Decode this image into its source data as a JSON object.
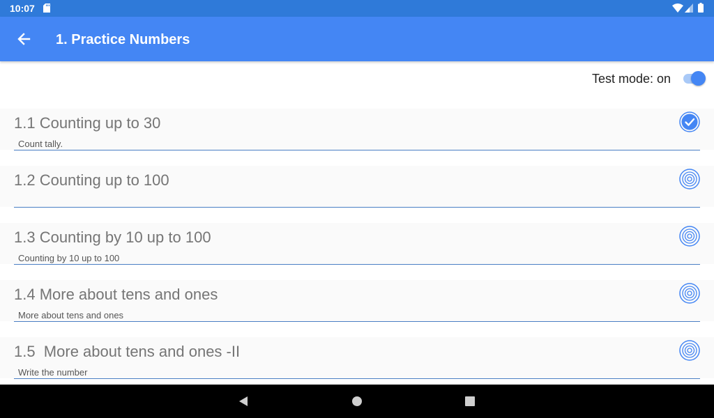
{
  "status_bar": {
    "time": "10:07",
    "color": "#2f7ad9"
  },
  "app_bar": {
    "title": "1. Practice Numbers",
    "color": "#4486f4"
  },
  "test_mode": {
    "label": "Test mode: on",
    "enabled": true
  },
  "lessons": [
    {
      "title": "1.1 Counting up to 30",
      "subtitle": "Count tally.",
      "status": "completed"
    },
    {
      "title": "1.2 Counting up to 100",
      "subtitle": "",
      "status": "target"
    },
    {
      "title": "1.3 Counting by 10 up to 100",
      "subtitle": "Counting by 10 up to 100",
      "status": "target"
    },
    {
      "title": "1.4 More about tens and ones",
      "subtitle": "More about tens and ones",
      "status": "target"
    },
    {
      "title": "1.5  More about tens and ones -II",
      "subtitle": "Write the number",
      "status": "target"
    }
  ],
  "icons": {
    "back": "arrow-back-icon",
    "completed": "check-circle-icon",
    "target": "target-icon"
  }
}
